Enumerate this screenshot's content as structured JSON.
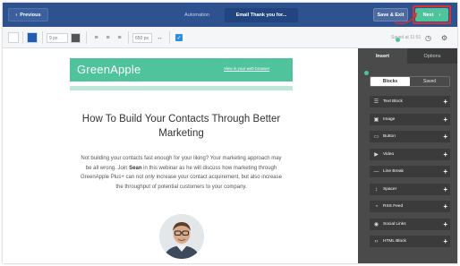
{
  "topbar": {
    "prev_label": "Previous",
    "tab_automation": "Automation",
    "tab_email": "Email Thank you for...",
    "save_label": "Save & Exit",
    "next_label": "Next"
  },
  "toolbar": {
    "font_size_value": "9",
    "font_size_unit": "px",
    "width_value": "650",
    "width_unit": "px",
    "saved_text": "Saved at 11:51",
    "colors": {
      "swatch_blue": "#1d5db5",
      "swatch_dark": "#555555"
    }
  },
  "email": {
    "brand": "GreenApple",
    "view_in_browser": "View in your web browser",
    "headline": "How To Build Your Contacts Through Better Marketing",
    "body_part1": "Not building your contacts fast enough for your liking? Your marketing approach may be all wrong. Join ",
    "body_bold": "Sean",
    "body_part2": " in this webinar as he will discuss how marketing through GreenApple Plus+ can not ",
    "body_italic": "only",
    "body_part3": " increase your contact acquirement, but also increase the throughput of potential customers to your company.",
    "colors": {
      "accent": "#4fc39c",
      "stripe": "#bde8d9"
    }
  },
  "panel": {
    "tab_insert": "Insert",
    "tab_options": "Options",
    "sub_blocks": "Blocks",
    "sub_saved": "Saved",
    "items": [
      {
        "label": "Text Block",
        "icon": "text-lines-icon"
      },
      {
        "label": "Image",
        "icon": "image-icon"
      },
      {
        "label": "Button",
        "icon": "button-icon"
      },
      {
        "label": "Video",
        "icon": "video-play-icon"
      },
      {
        "label": "Line Break",
        "icon": "line-break-icon"
      },
      {
        "label": "Spacer",
        "icon": "spacer-icon"
      },
      {
        "label": "RSS Feed",
        "icon": "rss-icon"
      },
      {
        "label": "Social Links",
        "icon": "social-icon"
      },
      {
        "label": "HTML Block",
        "icon": "code-icon"
      }
    ]
  }
}
